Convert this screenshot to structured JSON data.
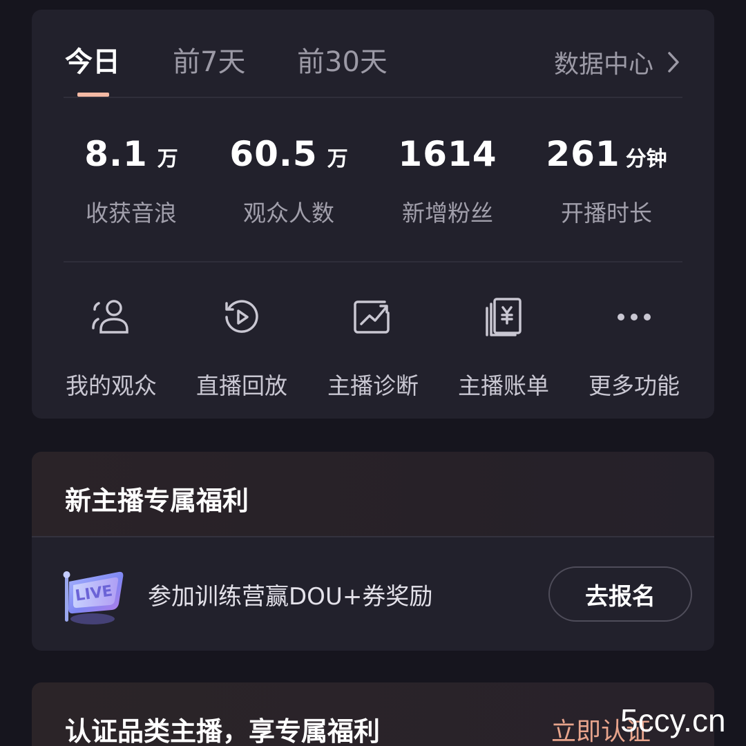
{
  "tabs": [
    {
      "label": "今日",
      "active": true
    },
    {
      "label": "前7天",
      "active": false
    },
    {
      "label": "前30天",
      "active": false
    }
  ],
  "data_center": {
    "label": "数据中心",
    "icon": "chevron-right-icon"
  },
  "metrics": [
    {
      "value": "8.1",
      "unit": "万",
      "label": "收获音浪"
    },
    {
      "value": "60.5",
      "unit": "万",
      "label": "观众人数"
    },
    {
      "value": "1614",
      "unit": "",
      "label": "新增粉丝"
    },
    {
      "value": "261",
      "unit": "分钟",
      "label": "开播时长"
    }
  ],
  "actions": [
    {
      "label": "我的观众",
      "icon": "audience-icon"
    },
    {
      "label": "直播回放",
      "icon": "replay-icon"
    },
    {
      "label": "主播诊断",
      "icon": "diagnosis-icon"
    },
    {
      "label": "主播账单",
      "icon": "bill-icon"
    },
    {
      "label": "更多功能",
      "icon": "more-icon"
    }
  ],
  "benefit": {
    "title": "新主播专属福利",
    "badge_text": "LIVE",
    "item_text": "参加训练营赢DOU+券奖励",
    "button_label": "去报名"
  },
  "certify": {
    "title": "认证品类主播，享专属福利",
    "link_label": "立即认证"
  },
  "watermark": "5ccy.cn",
  "colors": {
    "background": "#16151e",
    "card": "#22212c",
    "tab_indicator": "#f3b9a4",
    "link_accent": "#e8a48c"
  }
}
